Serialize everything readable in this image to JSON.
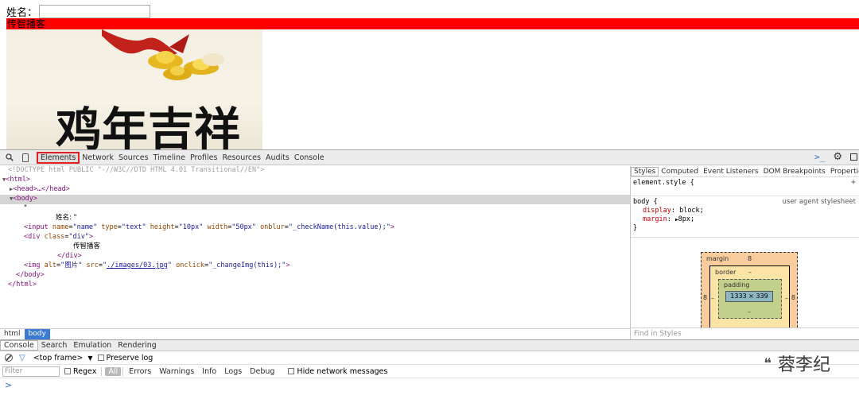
{
  "page": {
    "name_label": "姓名：",
    "red_div_text": "传智播客",
    "poster_text": "鸡年吉祥"
  },
  "devtools": {
    "tabs": [
      "Elements",
      "Network",
      "Sources",
      "Timeline",
      "Profiles",
      "Resources",
      "Audits",
      "Console"
    ],
    "active_tab": "Elements",
    "elements": {
      "doctype": "<!DOCTYPE html PUBLIC \"-//W3C//DTD HTML 4.01 Transitional//EN\">",
      "html_open": "<html>",
      "head": "<head>…</head>",
      "body_open": "<body>",
      "quote": "\"",
      "text_name": "姓名: \"",
      "input_tag": "input",
      "input_attrs": [
        {
          "name": "name",
          "value": "name"
        },
        {
          "name": "type",
          "value": "text"
        },
        {
          "name": "height",
          "value": "10px"
        },
        {
          "name": "width",
          "value": "50px"
        },
        {
          "name": "onblur",
          "value": "_checkName(this.value);"
        }
      ],
      "div_tag": "div",
      "div_class_attr": "class",
      "div_class_value": "div",
      "div_text": "传智播客",
      "div_close": "</div>",
      "img_tag": "img",
      "img_alt_attr": "alt",
      "img_alt_value": "图片",
      "img_src_attr": "src",
      "img_src_value": "./images/03.jpg",
      "img_onclick_attr": "onclick",
      "img_onclick_value": "_changeImg(this);",
      "body_close": "</body>",
      "html_close": "</html>"
    },
    "breadcrumb": [
      "html",
      "body"
    ],
    "sidebar": {
      "tabs": [
        "Styles",
        "Computed",
        "Event Listeners",
        "DOM Breakpoints",
        "Properties"
      ],
      "active_tab": "Styles",
      "element_style": "element.style {",
      "body_rule": "body {",
      "ua_label": "user agent stylesheet",
      "display_prop": "display",
      "display_val": "block;",
      "margin_prop": "margin",
      "margin_val": "8px;",
      "close_brace": "}",
      "box_model": {
        "margin_label": "margin",
        "margin_value": "8",
        "border_label": "border",
        "border_value": "–",
        "padding_label": "padding",
        "padding_value": "–",
        "content": "1333 × 339",
        "side_value": "8",
        "dash": "–"
      },
      "find_placeholder": "Find in Styles"
    },
    "drawer": {
      "tabs": [
        "Console",
        "Search",
        "Emulation",
        "Rendering"
      ],
      "active_tab": "Console",
      "frame": "<top frame>",
      "preserve_log": "Preserve log",
      "filter_placeholder": "Filter",
      "regex": "Regex",
      "levels": [
        "All",
        "Errors",
        "Warnings",
        "Info",
        "Logs",
        "Debug"
      ],
      "hide_network": "Hide network messages",
      "prompt": ">"
    }
  },
  "watermark": "蓉李纪"
}
